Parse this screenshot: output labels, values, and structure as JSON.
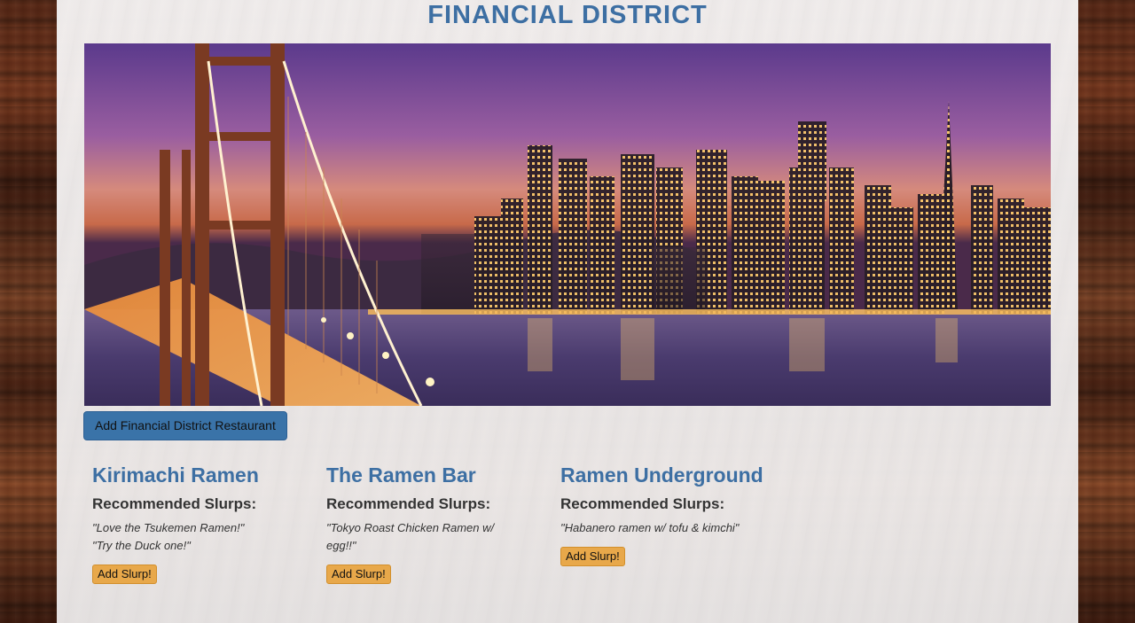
{
  "page": {
    "title": "FINANCIAL DISTRICT",
    "add_restaurant_label": "Add Financial District Restaurant"
  },
  "colors": {
    "title_blue": "#3d6fa3",
    "primary_button": "#3a73a8",
    "slurp_button": "#e8a84a"
  },
  "hero_image": {
    "icon": "city-skyline-bridge-photo"
  },
  "restaurants": [
    {
      "name": "Kirimachi Ramen",
      "rec_heading": "Recommended Slurps:",
      "slurps": [
        "\"Love the Tsukemen Ramen!\"",
        "\"Try the Duck one!\""
      ],
      "button": "Add Slurp!"
    },
    {
      "name": "The Ramen Bar",
      "rec_heading": "Recommended Slurps:",
      "slurps": [
        "\"Tokyo Roast Chicken Ramen w/ egg!!\""
      ],
      "button": "Add Slurp!"
    },
    {
      "name": "Ramen Underground",
      "rec_heading": "Recommended Slurps:",
      "slurps": [
        "\"Habanero ramen w/ tofu & kimchi\""
      ],
      "button": "Add Slurp!"
    }
  ]
}
